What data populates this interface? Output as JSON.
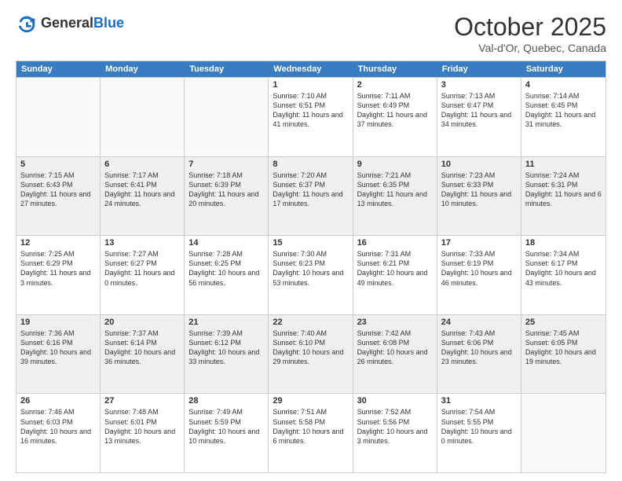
{
  "header": {
    "logo_general": "General",
    "logo_blue": "Blue",
    "month_title": "October 2025",
    "location": "Val-d'Or, Quebec, Canada"
  },
  "days_of_week": [
    "Sunday",
    "Monday",
    "Tuesday",
    "Wednesday",
    "Thursday",
    "Friday",
    "Saturday"
  ],
  "weeks": [
    [
      {
        "day": "",
        "info": "",
        "empty": true
      },
      {
        "day": "",
        "info": "",
        "empty": true
      },
      {
        "day": "",
        "info": "",
        "empty": true
      },
      {
        "day": "1",
        "info": "Sunrise: 7:10 AM\nSunset: 6:51 PM\nDaylight: 11 hours and 41 minutes."
      },
      {
        "day": "2",
        "info": "Sunrise: 7:11 AM\nSunset: 6:49 PM\nDaylight: 11 hours and 37 minutes."
      },
      {
        "day": "3",
        "info": "Sunrise: 7:13 AM\nSunset: 6:47 PM\nDaylight: 11 hours and 34 minutes."
      },
      {
        "day": "4",
        "info": "Sunrise: 7:14 AM\nSunset: 6:45 PM\nDaylight: 11 hours and 31 minutes."
      }
    ],
    [
      {
        "day": "5",
        "info": "Sunrise: 7:15 AM\nSunset: 6:43 PM\nDaylight: 11 hours and 27 minutes.",
        "shaded": true
      },
      {
        "day": "6",
        "info": "Sunrise: 7:17 AM\nSunset: 6:41 PM\nDaylight: 11 hours and 24 minutes.",
        "shaded": true
      },
      {
        "day": "7",
        "info": "Sunrise: 7:18 AM\nSunset: 6:39 PM\nDaylight: 11 hours and 20 minutes.",
        "shaded": true
      },
      {
        "day": "8",
        "info": "Sunrise: 7:20 AM\nSunset: 6:37 PM\nDaylight: 11 hours and 17 minutes.",
        "shaded": true
      },
      {
        "day": "9",
        "info": "Sunrise: 7:21 AM\nSunset: 6:35 PM\nDaylight: 11 hours and 13 minutes.",
        "shaded": true
      },
      {
        "day": "10",
        "info": "Sunrise: 7:23 AM\nSunset: 6:33 PM\nDaylight: 11 hours and 10 minutes.",
        "shaded": true
      },
      {
        "day": "11",
        "info": "Sunrise: 7:24 AM\nSunset: 6:31 PM\nDaylight: 11 hours and 6 minutes.",
        "shaded": true
      }
    ],
    [
      {
        "day": "12",
        "info": "Sunrise: 7:25 AM\nSunset: 6:29 PM\nDaylight: 11 hours and 3 minutes."
      },
      {
        "day": "13",
        "info": "Sunrise: 7:27 AM\nSunset: 6:27 PM\nDaylight: 11 hours and 0 minutes."
      },
      {
        "day": "14",
        "info": "Sunrise: 7:28 AM\nSunset: 6:25 PM\nDaylight: 10 hours and 56 minutes."
      },
      {
        "day": "15",
        "info": "Sunrise: 7:30 AM\nSunset: 6:23 PM\nDaylight: 10 hours and 53 minutes."
      },
      {
        "day": "16",
        "info": "Sunrise: 7:31 AM\nSunset: 6:21 PM\nDaylight: 10 hours and 49 minutes."
      },
      {
        "day": "17",
        "info": "Sunrise: 7:33 AM\nSunset: 6:19 PM\nDaylight: 10 hours and 46 minutes."
      },
      {
        "day": "18",
        "info": "Sunrise: 7:34 AM\nSunset: 6:17 PM\nDaylight: 10 hours and 43 minutes."
      }
    ],
    [
      {
        "day": "19",
        "info": "Sunrise: 7:36 AM\nSunset: 6:16 PM\nDaylight: 10 hours and 39 minutes.",
        "shaded": true
      },
      {
        "day": "20",
        "info": "Sunrise: 7:37 AM\nSunset: 6:14 PM\nDaylight: 10 hours and 36 minutes.",
        "shaded": true
      },
      {
        "day": "21",
        "info": "Sunrise: 7:39 AM\nSunset: 6:12 PM\nDaylight: 10 hours and 33 minutes.",
        "shaded": true
      },
      {
        "day": "22",
        "info": "Sunrise: 7:40 AM\nSunset: 6:10 PM\nDaylight: 10 hours and 29 minutes.",
        "shaded": true
      },
      {
        "day": "23",
        "info": "Sunrise: 7:42 AM\nSunset: 6:08 PM\nDaylight: 10 hours and 26 minutes.",
        "shaded": true
      },
      {
        "day": "24",
        "info": "Sunrise: 7:43 AM\nSunset: 6:06 PM\nDaylight: 10 hours and 23 minutes.",
        "shaded": true
      },
      {
        "day": "25",
        "info": "Sunrise: 7:45 AM\nSunset: 6:05 PM\nDaylight: 10 hours and 19 minutes.",
        "shaded": true
      }
    ],
    [
      {
        "day": "26",
        "info": "Sunrise: 7:46 AM\nSunset: 6:03 PM\nDaylight: 10 hours and 16 minutes."
      },
      {
        "day": "27",
        "info": "Sunrise: 7:48 AM\nSunset: 6:01 PM\nDaylight: 10 hours and 13 minutes."
      },
      {
        "day": "28",
        "info": "Sunrise: 7:49 AM\nSunset: 5:59 PM\nDaylight: 10 hours and 10 minutes."
      },
      {
        "day": "29",
        "info": "Sunrise: 7:51 AM\nSunset: 5:58 PM\nDaylight: 10 hours and 6 minutes."
      },
      {
        "day": "30",
        "info": "Sunrise: 7:52 AM\nSunset: 5:56 PM\nDaylight: 10 hours and 3 minutes."
      },
      {
        "day": "31",
        "info": "Sunrise: 7:54 AM\nSunset: 5:55 PM\nDaylight: 10 hours and 0 minutes."
      },
      {
        "day": "",
        "info": "",
        "empty": true
      }
    ]
  ]
}
